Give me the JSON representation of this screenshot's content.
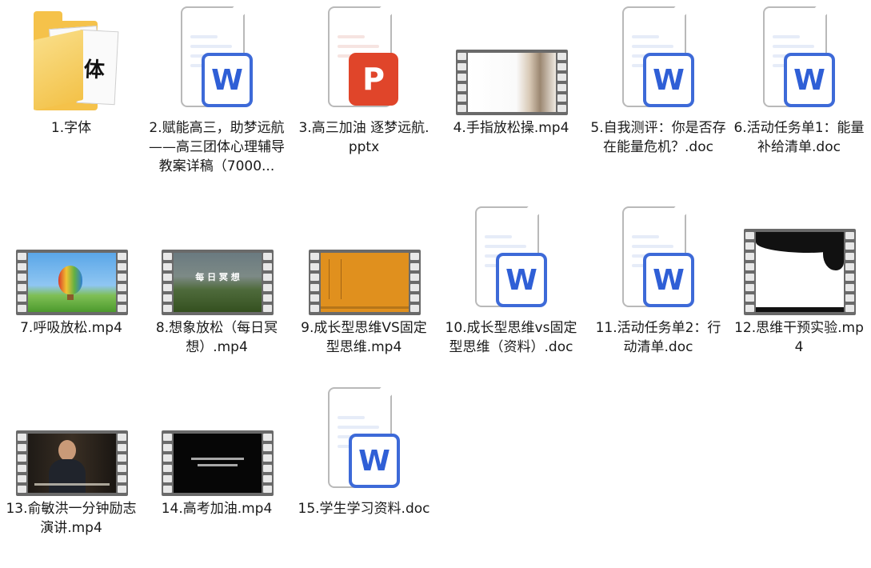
{
  "files": [
    {
      "name": "1.字体",
      "type": "folder",
      "folder_text": [
        "高体",
        "体"
      ]
    },
    {
      "name": "2.赋能高三，助梦远航——高三团体心理辅导教案详稿（7000...",
      "type": "doc",
      "badge": "W"
    },
    {
      "name": "3.高三加油 逐梦远航.pptx",
      "type": "ppt",
      "badge": "P"
    },
    {
      "name": "4.手指放松操.mp4",
      "type": "video"
    },
    {
      "name": "5.自我测评：你是否存在能量危机？.doc",
      "type": "doc",
      "badge": "W"
    },
    {
      "name": "6.活动任务单1：能量补给清单.doc",
      "type": "doc",
      "badge": "W"
    },
    {
      "name": "7.呼吸放松.mp4",
      "type": "video"
    },
    {
      "name": "8.想象放松（每日冥想）.mp4",
      "type": "video",
      "overlay_title": "每 日 冥 想"
    },
    {
      "name": "9.成长型思维VS固定型思维.mp4",
      "type": "video"
    },
    {
      "name": "10.成长型思维vs固定型思维（资料）.doc",
      "type": "doc",
      "badge": "W"
    },
    {
      "name": "11.活动任务单2：行动清单.doc",
      "type": "doc",
      "badge": "W"
    },
    {
      "name": "12.思维干预实验.mp4",
      "type": "video"
    },
    {
      "name": "13.俞敏洪一分钟励志演讲.mp4",
      "type": "video"
    },
    {
      "name": "14.高考加油.mp4",
      "type": "video"
    },
    {
      "name": "15.学生学习资料.doc",
      "type": "doc",
      "badge": "W"
    }
  ],
  "colors": {
    "word_blue": "#3d6ad8",
    "ppt_red": "#e0452a",
    "folder_yellow": "#f5c24a",
    "film_gray": "#6a6a6a"
  }
}
